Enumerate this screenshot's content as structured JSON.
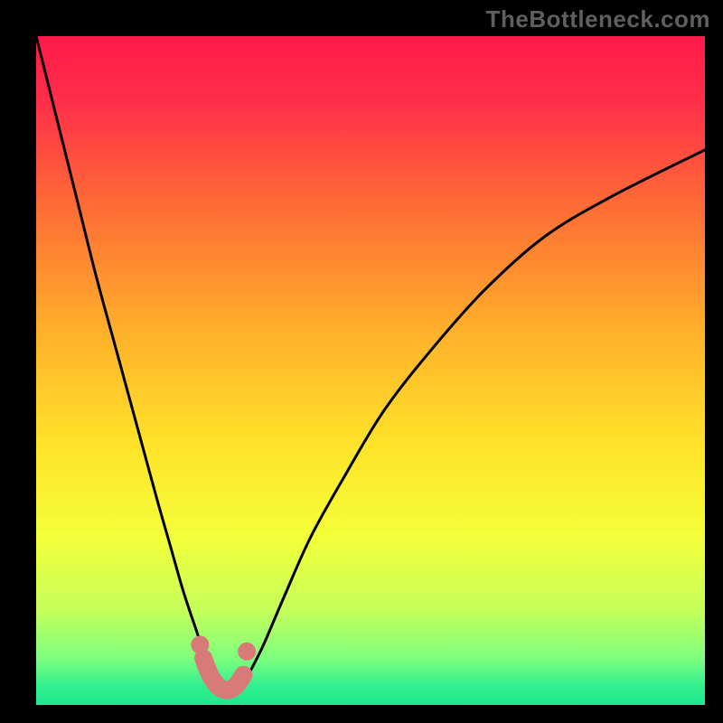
{
  "watermark": "TheBottleneck.com",
  "chart_data": {
    "type": "line",
    "title": "",
    "xlabel": "",
    "ylabel": "",
    "xlim": [
      0,
      100
    ],
    "ylim": [
      0,
      100
    ],
    "grid": false,
    "legend": false,
    "annotations": [],
    "background_gradient": {
      "type": "vertical",
      "stops": [
        {
          "offset": 0.0,
          "color": "#ff1a4b"
        },
        {
          "offset": 0.1,
          "color": "#ff2f49"
        },
        {
          "offset": 0.25,
          "color": "#ff6a36"
        },
        {
          "offset": 0.45,
          "color": "#ffb32a"
        },
        {
          "offset": 0.62,
          "color": "#ffe52a"
        },
        {
          "offset": 0.75,
          "color": "#f3ff3a"
        },
        {
          "offset": 0.86,
          "color": "#c4ff5a"
        },
        {
          "offset": 0.93,
          "color": "#7eff7e"
        },
        {
          "offset": 0.97,
          "color": "#34f08e"
        },
        {
          "offset": 1.0,
          "color": "#1ee890"
        }
      ]
    },
    "series": [
      {
        "name": "bottleneck-curve",
        "stroke": "#000000",
        "stroke_width": 3,
        "x": [
          0,
          3,
          6,
          9,
          12,
          15,
          18,
          20,
          22,
          24,
          25,
          26,
          27,
          28,
          29,
          30,
          31,
          32,
          34,
          37,
          41,
          46,
          52,
          59,
          67,
          76,
          86,
          100
        ],
        "y": [
          100,
          88,
          76,
          64,
          53,
          42,
          31,
          24,
          17,
          11,
          8,
          5.5,
          3.5,
          2.3,
          1.8,
          2.0,
          3.0,
          5.0,
          9,
          16,
          25,
          34,
          44,
          53,
          62,
          70,
          76,
          83
        ]
      }
    ],
    "markers": [
      {
        "name": "left-dot",
        "x": 24.5,
        "y": 9.0,
        "r": 10,
        "fill": "#d87a77"
      },
      {
        "name": "right-dot",
        "x": 31.5,
        "y": 8.0,
        "r": 10,
        "fill": "#d87a77"
      }
    ],
    "thick_segment": {
      "name": "valley-highlight",
      "stroke": "#d87a77",
      "stroke_width": 20,
      "x": [
        25.0,
        26.0,
        27.0,
        28.0,
        29.0,
        30.0,
        31.0
      ],
      "y": [
        7.0,
        4.5,
        3.0,
        2.3,
        2.3,
        3.0,
        4.5
      ]
    }
  }
}
